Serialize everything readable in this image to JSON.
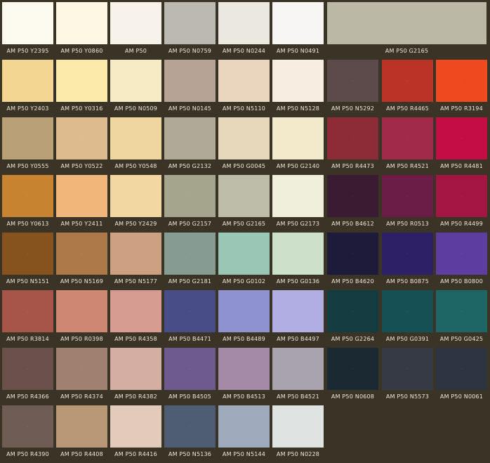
{
  "swatches": [
    [
      {
        "code": "AM P50 Y2395",
        "color": "#fcfaee"
      },
      {
        "code": "AM P50 Y0860",
        "color": "#fcf8e3"
      },
      {
        "code": "AM P50",
        "color": "#f8f3ea"
      },
      {
        "code": "AM P50 N0759",
        "color": "#bcb8b2"
      },
      {
        "code": "AM P50 N0244",
        "color": "#ebe8e0"
      },
      {
        "code": "AM P50 N0491",
        "color": "#f7f6f4"
      },
      {
        "code": "AM P50 G2165",
        "color": "#bbb9a5"
      }
    ],
    [
      {
        "code": "AM P50 Y2403",
        "color": "#f2d692"
      },
      {
        "code": "AM P50 Y0316",
        "color": "#faeaa9"
      },
      {
        "code": "AM P50 N0509",
        "color": "#f6ebc5"
      },
      {
        "code": "AM P50 N0145",
        "color": "#b7a396"
      },
      {
        "code": "AM P50 N5110",
        "color": "#ead5be"
      },
      {
        "code": "AM P50 N5128",
        "color": "#f7ede0"
      },
      {
        "code": "AM P50 N5292",
        "color": "#5d4b4c"
      },
      {
        "code": "AM P50 R4465",
        "color": "#bb3327"
      },
      {
        "code": "AM P50 R3194",
        "color": "#ee4a1d"
      }
    ],
    [
      {
        "code": "AM P50 Y0555",
        "color": "#baa076"
      },
      {
        "code": "AM P50 Y0522",
        "color": "#ddbb8e"
      },
      {
        "code": "AM P50 Y0548",
        "color": "#efd69f"
      },
      {
        "code": "AM P50 G2132",
        "color": "#b1a998"
      },
      {
        "code": "AM P50 G0045",
        "color": "#e7d7bb"
      },
      {
        "code": "AM P50 G2140",
        "color": "#f3eacb"
      },
      {
        "code": "AM P50 R4473",
        "color": "#8d2b37"
      },
      {
        "code": "AM P50 R4521",
        "color": "#a1294a"
      },
      {
        "code": "AM P50 R4481",
        "color": "#c50d45"
      }
    ],
    [
      {
        "code": "AM P50 Y0613",
        "color": "#c88331"
      },
      {
        "code": "AM P50 Y2411",
        "color": "#f1b77a"
      },
      {
        "code": "AM P50 Y2429",
        "color": "#f3d7a3"
      },
      {
        "code": "AM P50 G2157",
        "color": "#a5a48d"
      },
      {
        "code": "AM P50 G2165",
        "color": "#bcbca8"
      },
      {
        "code": "AM P50 G2173",
        "color": "#f0efdc"
      },
      {
        "code": "AM P50 B4612",
        "color": "#3a1b31"
      },
      {
        "code": "AM P50 R0513",
        "color": "#6b1d48"
      },
      {
        "code": "AM P50 R4499",
        "color": "#a51543"
      }
    ],
    [
      {
        "code": "AM P50 N5151",
        "color": "#86521e"
      },
      {
        "code": "AM P50 N5169",
        "color": "#ad7949"
      },
      {
        "code": "AM P50 N5177",
        "color": "#cda081"
      },
      {
        "code": "AM P50 G2181",
        "color": "#869b91"
      },
      {
        "code": "AM P50 G0102",
        "color": "#9ac6b5"
      },
      {
        "code": "AM P50 G0136",
        "color": "#cce0ca"
      },
      {
        "code": "AM P50 B4620",
        "color": "#1e1b3a"
      },
      {
        "code": "AM P50 B0875",
        "color": "#2e2066"
      },
      {
        "code": "AM P50 B0800",
        "color": "#5d3ea0"
      }
    ],
    [
      {
        "code": "AM P50 R3814",
        "color": "#a75548"
      },
      {
        "code": "AM P50 R0398",
        "color": "#ce8872"
      },
      {
        "code": "AM P50 R4358",
        "color": "#d69c91"
      },
      {
        "code": "AM P50 B4471",
        "color": "#484d87"
      },
      {
        "code": "AM P50 B4489",
        "color": "#8e93cf"
      },
      {
        "code": "AM P50 B4497",
        "color": "#b0aee2"
      },
      {
        "code": "AM P50 G2264",
        "color": "#143c41"
      },
      {
        "code": "AM P50 G0391",
        "color": "#165054"
      },
      {
        "code": "AM P50 G0425",
        "color": "#1e6666"
      }
    ],
    [
      {
        "code": "AM P50 R4366",
        "color": "#6b4f4b"
      },
      {
        "code": "AM P50 R4374",
        "color": "#a08070"
      },
      {
        "code": "AM P50 R4382",
        "color": "#d4aea3"
      },
      {
        "code": "AM P50 B4505",
        "color": "#6f5a8f"
      },
      {
        "code": "AM P50 B4513",
        "color": "#a58aa8"
      },
      {
        "code": "AM P50 B4521",
        "color": "#a9a3ad"
      },
      {
        "code": "AM P50 N0608",
        "color": "#1b2933"
      },
      {
        "code": "AM P50 N5573",
        "color": "#363a44"
      },
      {
        "code": "AM P50 N0061",
        "color": "#2c3441"
      }
    ],
    [
      {
        "code": "AM P50 R4390",
        "color": "#6f5d55"
      },
      {
        "code": "AM P50 R4408",
        "color": "#b99876"
      },
      {
        "code": "AM P50 R4416",
        "color": "#e3cbbb"
      },
      {
        "code": "AM P50 N5136",
        "color": "#4e5c74"
      },
      {
        "code": "AM P50 N5144",
        "color": "#9eaabc"
      },
      {
        "code": "AM P50 N0228",
        "color": "#dfe3e2"
      }
    ]
  ]
}
